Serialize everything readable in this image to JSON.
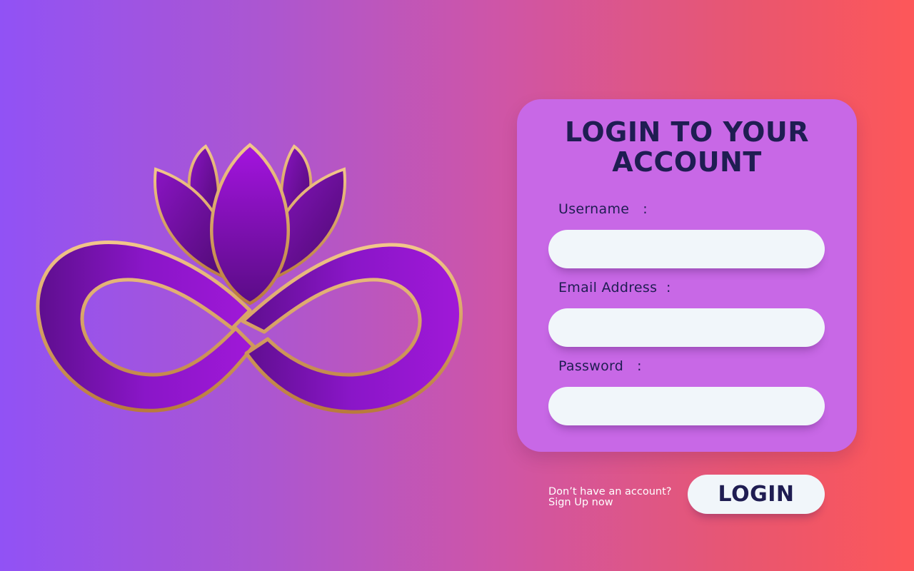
{
  "brand": {
    "logo_icon": "infinity-lotus-logo",
    "colors": {
      "petal_dark": "#4b0a6e",
      "petal_mid": "#7a14ad",
      "petal_light": "#a012d8",
      "gold": "#d8a062",
      "ribbon": "#6a10a0"
    }
  },
  "form": {
    "title": "LOGIN TO YOUR ACCOUNT",
    "fields": [
      {
        "label": "Username   :",
        "value": "",
        "placeholder": ""
      },
      {
        "label": "Email Address  :",
        "value": "",
        "placeholder": ""
      },
      {
        "label": "Password   :",
        "value": "",
        "placeholder": ""
      }
    ],
    "signup_prompt": "Don’t have an account?",
    "signup_link": "Sign Up now",
    "login_label": "LOGIN"
  },
  "theme": {
    "card_bg": "#c868e6",
    "text_dark": "#1f1d52",
    "field_bg": "#f1f6fa",
    "gradient_start": "#9152f5",
    "gradient_end": "#fd5759"
  }
}
